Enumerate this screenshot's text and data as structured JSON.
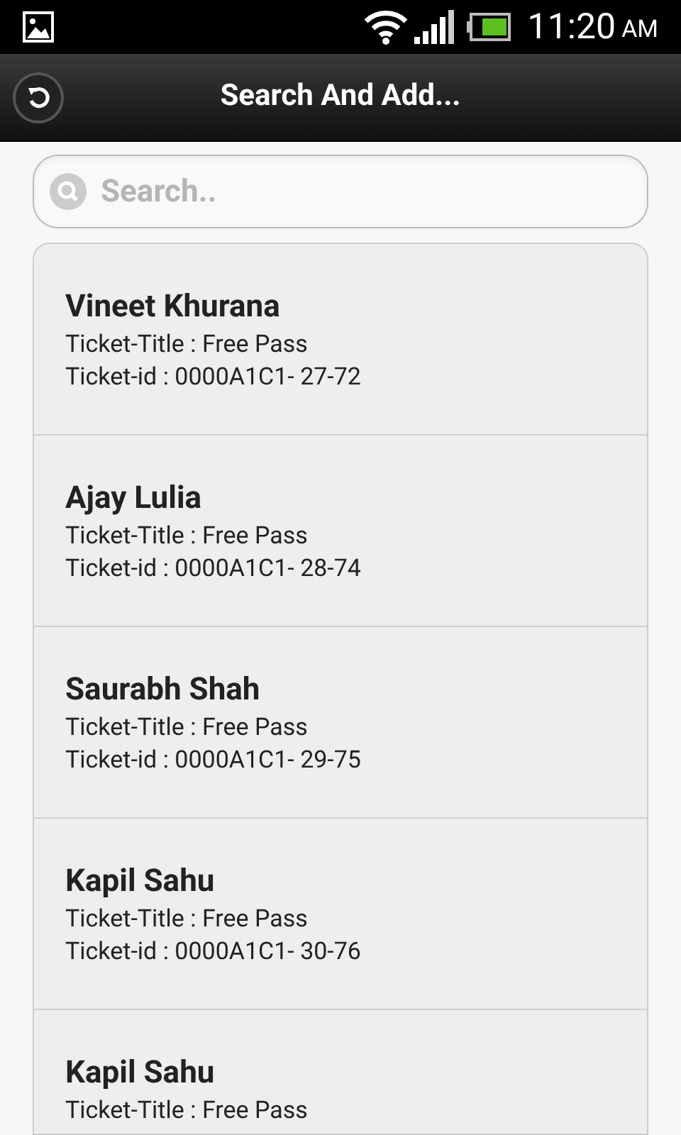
{
  "status_bar": {
    "time": "11:20",
    "period": "AM"
  },
  "header": {
    "title": "Search And Add..."
  },
  "search": {
    "placeholder": "Search.."
  },
  "contacts": [
    {
      "name": "Vineet Khurana",
      "lines": [
        "Ticket-Title : Free Pass",
        "Ticket-id : 0000A1C1- 27-72"
      ]
    },
    {
      "name": "Ajay Lulia",
      "lines": [
        "Ticket-Title : Free Pass",
        "Ticket-id : 0000A1C1- 28-74"
      ]
    },
    {
      "name": "Saurabh Shah",
      "lines": [
        "Ticket-Title : Free Pass",
        "Ticket-id : 0000A1C1- 29-75"
      ]
    },
    {
      "name": "Kapil Sahu",
      "lines": [
        "Ticket-Title : Free Pass",
        "Ticket-id : 0000A1C1- 30-76"
      ]
    },
    {
      "name": "Kapil Sahu",
      "lines": [
        "Ticket-Title : Free Pass"
      ]
    }
  ]
}
